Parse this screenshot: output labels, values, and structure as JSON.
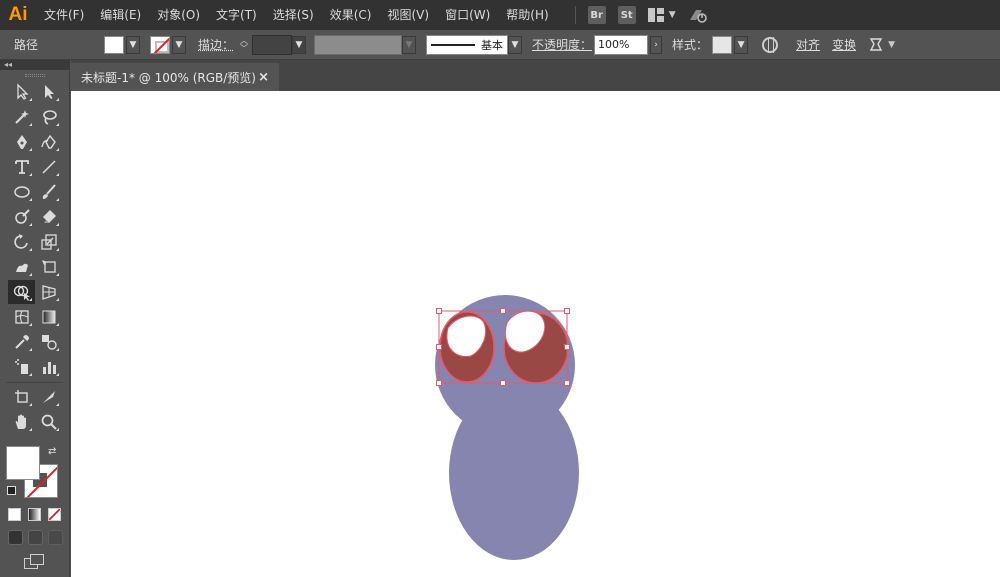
{
  "app": {
    "logo": "Ai",
    "menu": [
      "文件(F)",
      "编辑(E)",
      "对象(O)",
      "文字(T)",
      "选择(S)",
      "效果(C)",
      "视图(V)",
      "窗口(W)",
      "帮助(H)"
    ],
    "bridge_badge": "Br",
    "stock_badge": "St"
  },
  "control": {
    "selection_type": "路径",
    "stroke_label": "描边：",
    "profile_label": "基本",
    "opacity_label": "不透明度：",
    "opacity_value": "100%",
    "style_label": "样式：",
    "align_label": "对齐",
    "transform_label": "变换"
  },
  "tools_panel": {
    "collapse_glyph": "◂◂",
    "active_tool": "shape-builder-tool"
  },
  "document": {
    "tab_title": "未标题-1* @ 100% (RGB/预览)",
    "close_glyph": "×"
  },
  "artwork": {
    "body_color": "#8585b0",
    "eye_color": "#9a4845",
    "highlight_color": "#ffffff",
    "selection_color": "#e8576a"
  }
}
